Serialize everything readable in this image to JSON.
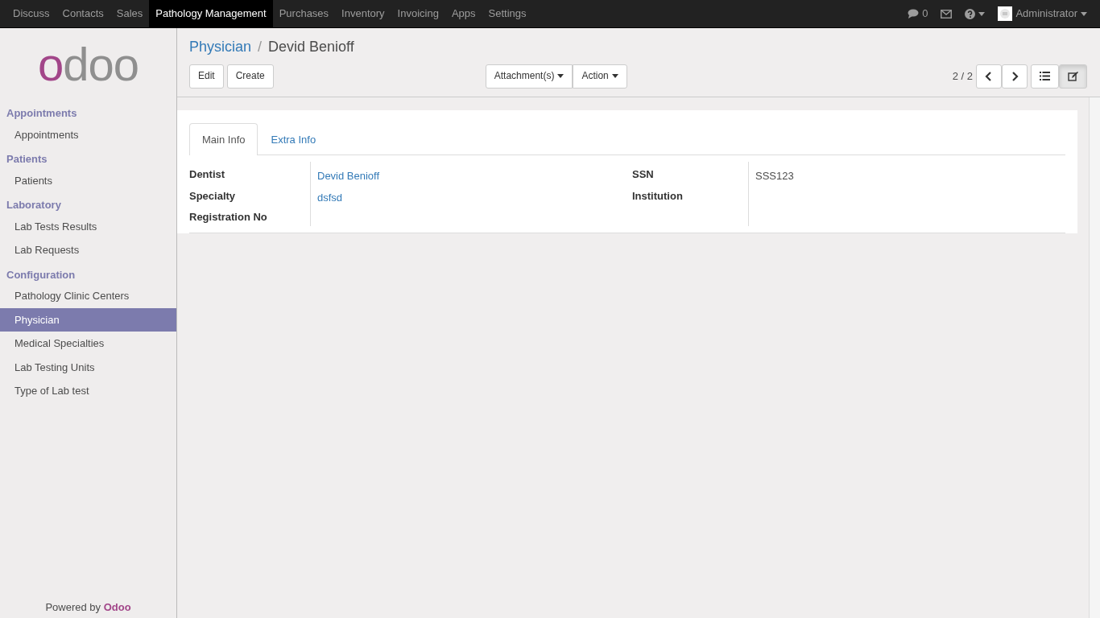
{
  "top_menu": [
    {
      "label": "Discuss",
      "selected": false
    },
    {
      "label": "Contacts",
      "selected": false
    },
    {
      "label": "Sales",
      "selected": false
    },
    {
      "label": "Pathology Management",
      "selected": true
    },
    {
      "label": "Purchases",
      "selected": false
    },
    {
      "label": "Inventory",
      "selected": false
    },
    {
      "label": "Invoicing",
      "selected": false
    },
    {
      "label": "Apps",
      "selected": false
    },
    {
      "label": "Settings",
      "selected": false
    }
  ],
  "systray": {
    "chat_count": "0",
    "user": "Administrator"
  },
  "logo": "odoo",
  "sidebar": [
    {
      "heading": "Appointments",
      "items": [
        {
          "label": "Appointments",
          "selected": false
        }
      ]
    },
    {
      "heading": "Patients",
      "items": [
        {
          "label": "Patients",
          "selected": false
        }
      ]
    },
    {
      "heading": "Laboratory",
      "items": [
        {
          "label": "Lab Tests Results",
          "selected": false
        },
        {
          "label": "Lab Requests",
          "selected": false
        }
      ]
    },
    {
      "heading": "Configuration",
      "items": [
        {
          "label": "Pathology Clinic Centers",
          "selected": false
        },
        {
          "label": "Physician",
          "selected": true
        },
        {
          "label": "Medical Specialties",
          "selected": false
        },
        {
          "label": "Lab Testing Units",
          "selected": false
        },
        {
          "label": "Type of Lab test",
          "selected": false
        }
      ]
    }
  ],
  "powered_by": {
    "text": "Powered by",
    "brand": "Odoo"
  },
  "breadcrumb": [
    {
      "label": "Physician"
    },
    {
      "label": "Devid Benioff"
    }
  ],
  "breadcrumb_separator": "/",
  "buttons": [
    "Edit",
    "Create"
  ],
  "dropdowns": [
    "Attachment(s)",
    "Action"
  ],
  "pager": "2 / 2",
  "views": [
    {
      "kind": "list",
      "selected": false
    },
    {
      "kind": "form",
      "selected": true
    }
  ],
  "tabs": [
    {
      "label": "Main Info",
      "selected": true
    },
    {
      "label": "Extra Info",
      "selected": false
    }
  ],
  "fields_left": [
    {
      "label": "Dentist",
      "value": "Devid Benioff",
      "link": true
    },
    {
      "label": "Specialty",
      "value": "dsfsd",
      "link": true
    },
    {
      "label": "Registration No"
    }
  ],
  "fields_right": [
    {
      "label": "SSN",
      "value": "SSS123",
      "link": false
    },
    {
      "label": "Institution"
    }
  ]
}
